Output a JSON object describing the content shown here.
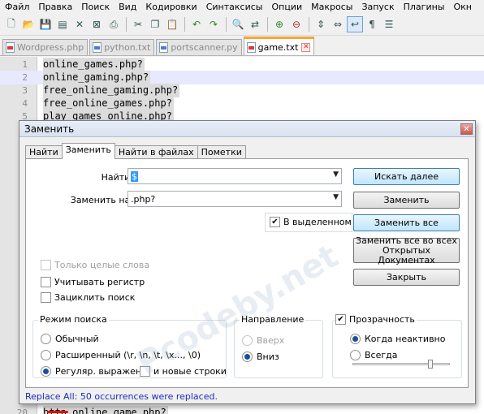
{
  "menubar": {
    "items": [
      "Файл",
      "Правка",
      "Поиск",
      "Вид",
      "Кодировки",
      "Синтаксисы",
      "Опции",
      "Макросы",
      "Запуск",
      "Плагины",
      "Окн"
    ]
  },
  "toolbar": {
    "icons": [
      "new-file-icon",
      "open-file-icon",
      "save-icon",
      "save-all-icon",
      "close-icon",
      "close-all-icon",
      "print-icon",
      "cut-icon",
      "copy-icon",
      "paste-icon",
      "undo-icon",
      "redo-icon",
      "find-icon",
      "replace-icon",
      "zoom-in-icon",
      "zoom-out-icon",
      "sync-vertical-icon",
      "sync-horizontal-icon",
      "word-wrap-icon",
      "show-all-chars-icon",
      "indent-guide-icon"
    ]
  },
  "tabs": [
    {
      "label": "Wordpress.php",
      "icon": "red"
    },
    {
      "label": "python.txt",
      "icon": "blue"
    },
    {
      "label": "portscanner.py",
      "icon": "blue"
    },
    {
      "label": "game.txt",
      "icon": "red",
      "active": true
    }
  ],
  "editor": {
    "lines": [
      {
        "num": "1",
        "code": "online_games.php?"
      },
      {
        "num": "2",
        "code": "online_gaming.php?"
      },
      {
        "num": "3",
        "code": "free_online_gaming.php?"
      },
      {
        "num": "4",
        "code": "free_online_games.php?"
      },
      {
        "num": "5",
        "code": "play_games_online.php?"
      },
      {
        "num": "20",
        "code": "http_online_game.php?"
      }
    ]
  },
  "dialog": {
    "title": "Заменить",
    "tabs": [
      "Найти",
      "Заменить",
      "Найти в файлах",
      "Пометки"
    ],
    "find_label": "Найти:",
    "find_value": "$",
    "replace_label": "Заменить на:",
    "replace_value": ".php?",
    "buttons": {
      "find_next": "Искать далее",
      "replace": "Заменить",
      "replace_all": "Заменить все",
      "replace_all_open_line1": "Заменить все во всех",
      "replace_all_open_line2": "Открытых Документах",
      "close": "Закрыть"
    },
    "in_selection": {
      "label": "В выделенном",
      "checked": true
    },
    "whole_word": {
      "label": "Только целые слова",
      "checked": false,
      "disabled": true
    },
    "match_case": {
      "label": "Учитывать регистр",
      "checked": false
    },
    "wrap_around": {
      "label": "Зациклить поиск",
      "checked": false
    },
    "search_mode": {
      "title": "Режим поиска",
      "normal": "Обычный",
      "extended": "Расширенный (\\r, \\n, \\t, \\x..., \\0)",
      "regex": "Регуляр. выражен.",
      "newline": "и новые строки",
      "selected": "regex"
    },
    "direction": {
      "title": "Направление",
      "up": "Вверх",
      "down": "Вниз",
      "selected": "down"
    },
    "transparency": {
      "title": "Прозрачность",
      "checked": true,
      "on_losing_focus": "Когда неактивно",
      "always": "Всегда",
      "selected": "on_losing_focus",
      "level": 0.8
    },
    "status": "Replace All: 50 occurrences were replaced."
  },
  "watermark": "Pcodeby.net"
}
